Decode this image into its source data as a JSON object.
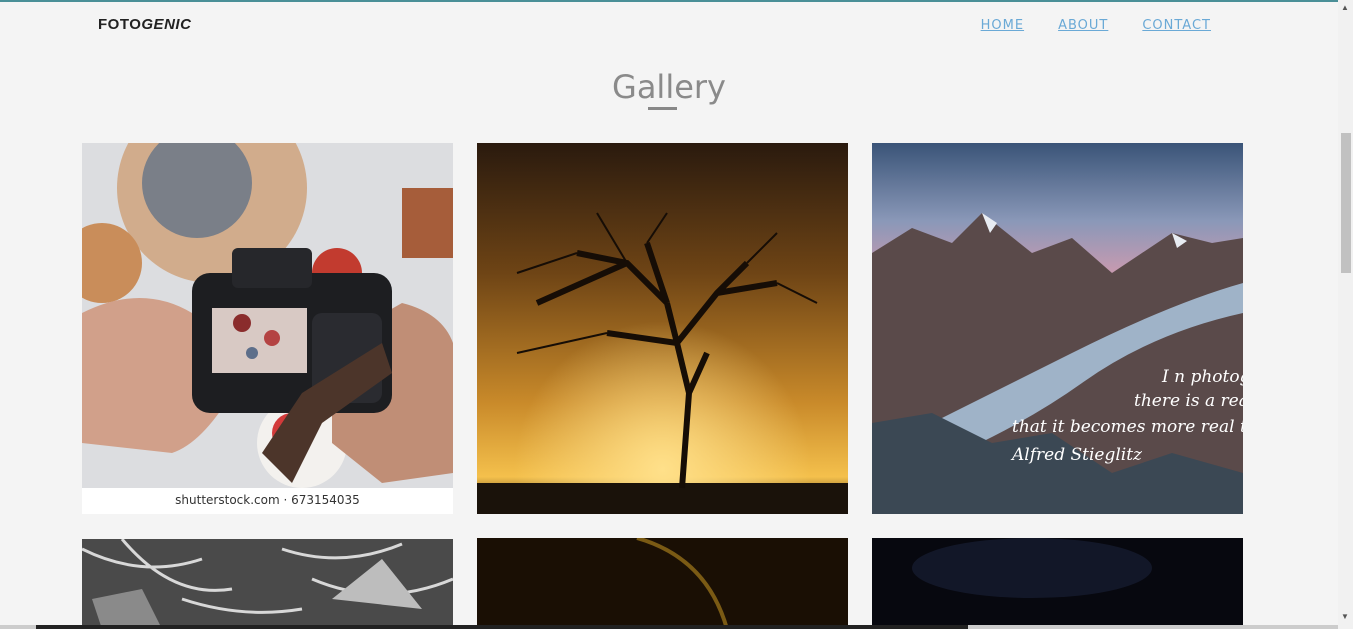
{
  "brand": {
    "part1": "FOTO",
    "part2": "GENIC"
  },
  "nav": {
    "home": "HOME",
    "about": "ABOUT",
    "contact": "CONTACT"
  },
  "title": "Gallery",
  "tiles": {
    "camera": {
      "caption": "shutterstock.com · 673154035"
    },
    "glacier": {
      "quote_lines": [
        "I n photog",
        "there is a realit",
        "that it becomes more real than re",
        "Alfred Stieglitz"
      ]
    }
  },
  "colors": {
    "accent": "#6aa9d6",
    "background": "#f4f4f4"
  }
}
